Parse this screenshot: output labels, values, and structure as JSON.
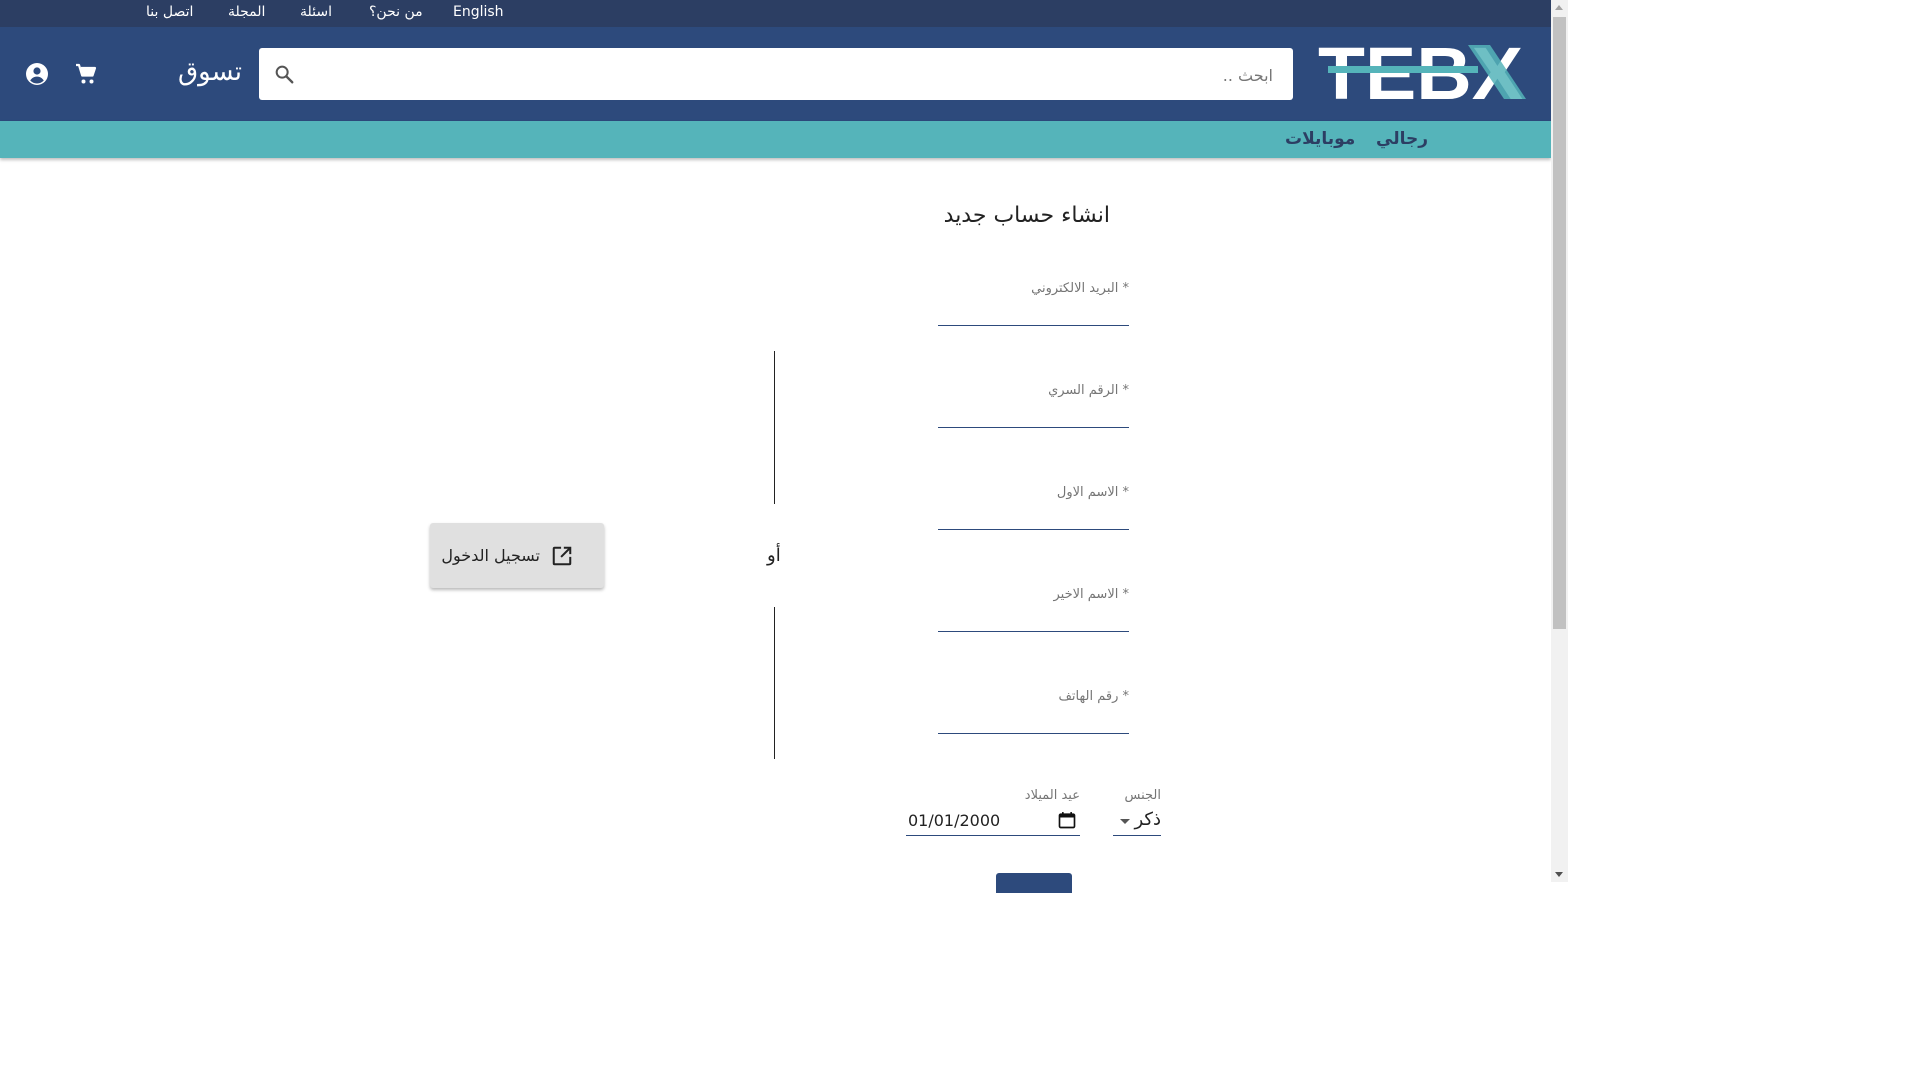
{
  "topbar": {
    "links": [
      "English",
      "من نحن؟",
      "اسئلة",
      "المجلة",
      "اتصل بنا"
    ]
  },
  "header": {
    "logo_text": "TEBX",
    "search_placeholder": "ابحث ..",
    "shop_label": "تسوق",
    "icons": [
      "search-icon",
      "cart-icon",
      "account-icon"
    ]
  },
  "categories": [
    "رجالي",
    "موبايلات"
  ],
  "form": {
    "title": "انشاء حساب جديد",
    "fields": [
      {
        "label": "البريد الالكتروني *",
        "value": ""
      },
      {
        "label": "الرقم السري *",
        "value": ""
      },
      {
        "label": "الاسم الاول *",
        "value": ""
      },
      {
        "label": "الاسم الاخير *",
        "value": ""
      },
      {
        "label": "رقم الهاتف *",
        "value": ""
      }
    ],
    "gender": {
      "label": "الجنس",
      "value": "ذكر"
    },
    "birthday": {
      "label": "عيد الميلاد",
      "value": "01/01/2000"
    }
  },
  "or_label": "أو",
  "login_button": {
    "label": "تسجيل الدخول",
    "icon": "open-in-new-icon"
  },
  "colors": {
    "topbar": "#2c3e63",
    "header": "#2d4a7c",
    "category_bar": "#55b4ba",
    "logo_accent": "#55b4ba",
    "logo_text": "#ffffff"
  }
}
